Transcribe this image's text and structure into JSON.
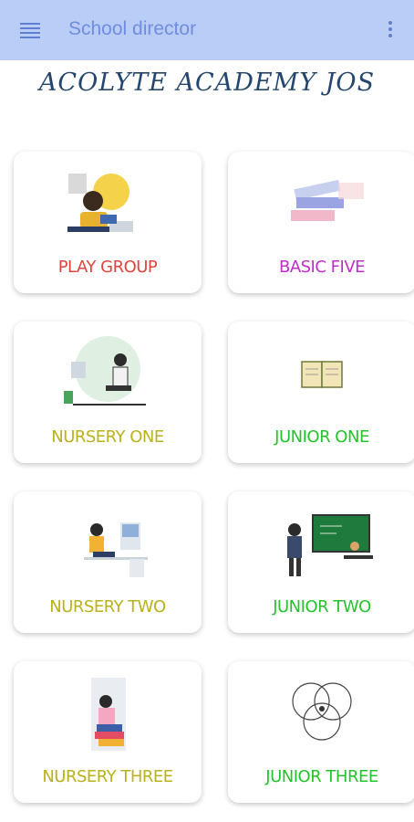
{
  "appbar": {
    "title": "School director",
    "menu_icon": "hamburger-menu-icon",
    "more_icon": "more-vert-icon",
    "background": "#b9cdf7"
  },
  "school_name": "ACOLYTE ACADEMY JOS",
  "classes": [
    {
      "label": "PLAY GROUP",
      "color": "#e0453d",
      "image": "student-reading-illustration"
    },
    {
      "label": "BASIC FIVE",
      "color": "#c12ccc",
      "image": "stack-of-books-illustration"
    },
    {
      "label": "NURSERY ONE",
      "color": "#b9b11d",
      "image": "student-at-desk-illustration"
    },
    {
      "label": "JUNIOR ONE",
      "color": "#23c42b",
      "image": "open-book-illustration"
    },
    {
      "label": "NURSERY TWO",
      "color": "#b9b11d",
      "image": "student-studying-illustration"
    },
    {
      "label": "JUNIOR TWO",
      "color": "#23c42b",
      "image": "teacher-at-chalkboard-illustration"
    },
    {
      "label": "NURSERY THREE",
      "color": "#b9b11d",
      "image": "student-with-books-illustration"
    },
    {
      "label": "JUNIOR THREE",
      "color": "#23c42b",
      "image": "venn-diagram-illustration"
    }
  ]
}
